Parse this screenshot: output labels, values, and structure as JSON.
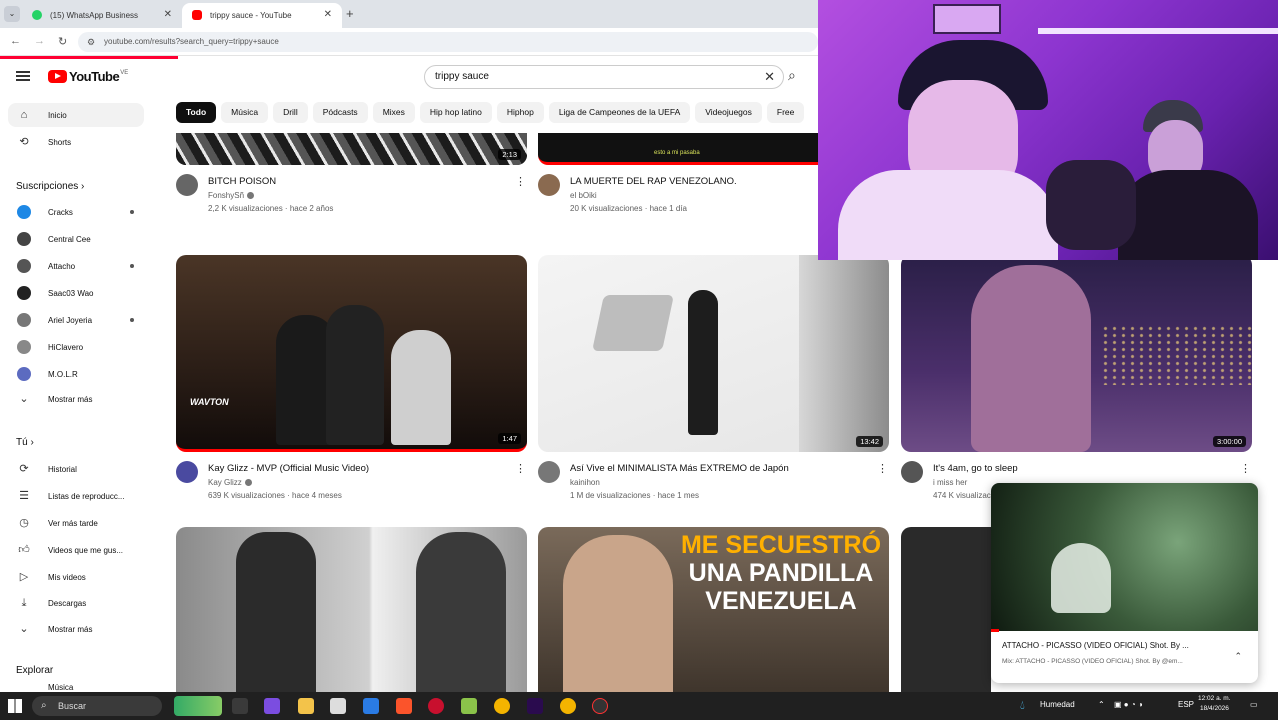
{
  "browser": {
    "tabs": [
      {
        "title": "(15) WhatsApp Business",
        "icon": "whatsapp-icon",
        "active": false
      },
      {
        "title": "trippy sauce - YouTube",
        "icon": "youtube-icon",
        "active": true
      }
    ],
    "url": "youtube.com/results?search_query=trippy+sauce"
  },
  "youtube": {
    "logo_text": "YouTube",
    "country_code": "VE",
    "search_value": "trippy sauce"
  },
  "sidebar": {
    "main": [
      {
        "label": "Inicio",
        "icon": "home-icon"
      },
      {
        "label": "Shorts",
        "icon": "shorts-icon"
      }
    ],
    "subs_header": "Suscripciones",
    "subs": [
      {
        "label": "Cracks",
        "color": "#1e88e5",
        "dot": true
      },
      {
        "label": "Central Cee",
        "color": "#444444",
        "dot": false
      },
      {
        "label": "Attacho",
        "color": "#555555",
        "dot": true
      },
      {
        "label": "Saac03 Wao",
        "color": "#222222",
        "dot": false
      },
      {
        "label": "Ariel Joyeria",
        "color": "#777777",
        "dot": true
      },
      {
        "label": "HiClavero",
        "color": "#888888",
        "dot": false
      },
      {
        "label": "M.O.L.R",
        "color": "#5c6bc0",
        "dot": false
      },
      {
        "label": "Mostrar más",
        "icon": "chevron-down-icon"
      }
    ],
    "you_header": "Tú",
    "you": [
      {
        "label": "Historial",
        "icon": "history-icon"
      },
      {
        "label": "Listas de reproducc...",
        "icon": "playlist-icon"
      },
      {
        "label": "Ver más tarde",
        "icon": "clock-icon"
      },
      {
        "label": "Videos que me gus...",
        "icon": "thumbs-up-icon"
      },
      {
        "label": "Mis videos",
        "icon": "my-videos-icon"
      },
      {
        "label": "Descargas",
        "icon": "download-icon"
      },
      {
        "label": "Mostrar más",
        "icon": "chevron-down-icon"
      }
    ],
    "explore_header": "Explorar",
    "explore_first": "Música"
  },
  "chips": [
    "Todo",
    "Música",
    "Drill",
    "Pódcasts",
    "Mixes",
    "Hip hop latino",
    "Hiphop",
    "Liga de Campeones de la UEFA",
    "Videojuegos",
    "Free"
  ],
  "videos": [
    {
      "title": "BITCH POISON",
      "channel": "FonshySñ",
      "verified": true,
      "stats": "2,2 K visualizaciones · hace 2 años",
      "duration": "2:13",
      "thumb": "#2b2b2b",
      "avatar": "#666666"
    },
    {
      "title": "LA MUERTE DEL RAP VENEZOLANO.",
      "channel": "el bOiki",
      "verified": false,
      "stats": "20 K visualizaciones · hace 1 día",
      "duration": "",
      "thumb": "#111111",
      "caption": "esto a mi pasaba",
      "avatar": "#8a6a50"
    },
    {
      "title": "Kay Glizz - MVP (Official Music Video)",
      "channel": "Kay Glizz",
      "verified": true,
      "stats": "639 K visualizaciones · hace 4 meses",
      "duration": "1:47",
      "thumb": "#3a2a20",
      "thumb_text": "WAVTON",
      "avatar": "#4a4aa0"
    },
    {
      "title": "Así Vive el MINIMALISTA Más EXTREMO de Japón",
      "channel": "kainihon",
      "verified": false,
      "stats": "1 M de visualizaciones · hace 1 mes",
      "duration": "13:42",
      "thumb": "#ececec",
      "avatar": "#777777"
    },
    {
      "title": "It's 4am, go to sleep",
      "channel": "i miss her",
      "verified": false,
      "stats": "474 K visualizaciones",
      "duration": "3:00:00",
      "thumb": "#4b2f6b",
      "avatar": "#555555"
    },
    {
      "title": "",
      "thumb": "#b8b8b8"
    },
    {
      "title": "",
      "thumb": "#5a4a3a",
      "thumb_text_lines": [
        "ME SECUESTRÓ",
        "UNA PANDILLA",
        "VENEZUELA"
      ]
    },
    {
      "title": "",
      "thumb": "#2a2a2a"
    }
  ],
  "mini_player": {
    "title": "ATTACHO - PICASSO (VIDEO OFICIAL) Shot. By ...",
    "subtitle": "Mix: ATTACHO - PICASSO (VIDEO OFICIAL) Shot. By @em..."
  },
  "taskbar": {
    "search_placeholder": "Buscar",
    "weather": "Humedad",
    "language": "ESP",
    "time": "12:02 a. m.",
    "date": "18/4/2026"
  }
}
